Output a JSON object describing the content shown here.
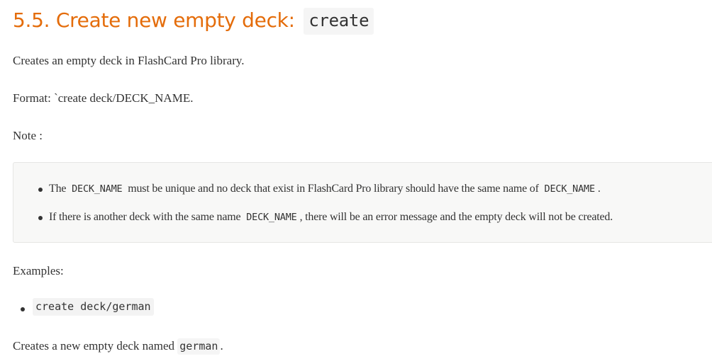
{
  "section": {
    "title": "5.5. Create new empty deck:",
    "command_code": "create"
  },
  "description": "Creates an empty deck in FlashCard Pro library.",
  "format": "Format: `create deck/DECK_NAME.",
  "note_label": "Note :",
  "notes": [
    {
      "prefix": "The",
      "code": "DECK_NAME",
      "middle": "must be unique and no deck that exist in FlashCard Pro library should have the same name of",
      "code2": "DECK_NAME",
      "suffix": "."
    },
    {
      "prefix": "If there is another deck with the same name",
      "code": "DECK_NAME",
      "suffix": ", there will be an error message and the empty deck will not be created."
    }
  ],
  "examples_label": "Examples:",
  "examples": [
    {
      "code": "create deck/german"
    }
  ],
  "result": {
    "prefix": "Creates a new empty deck named",
    "code": "german",
    "suffix": "."
  },
  "colors": {
    "heading": "#e46c0a",
    "body_text": "#333333",
    "callout_background": "#f8f8f7",
    "code_background": "#f5f5f5"
  }
}
